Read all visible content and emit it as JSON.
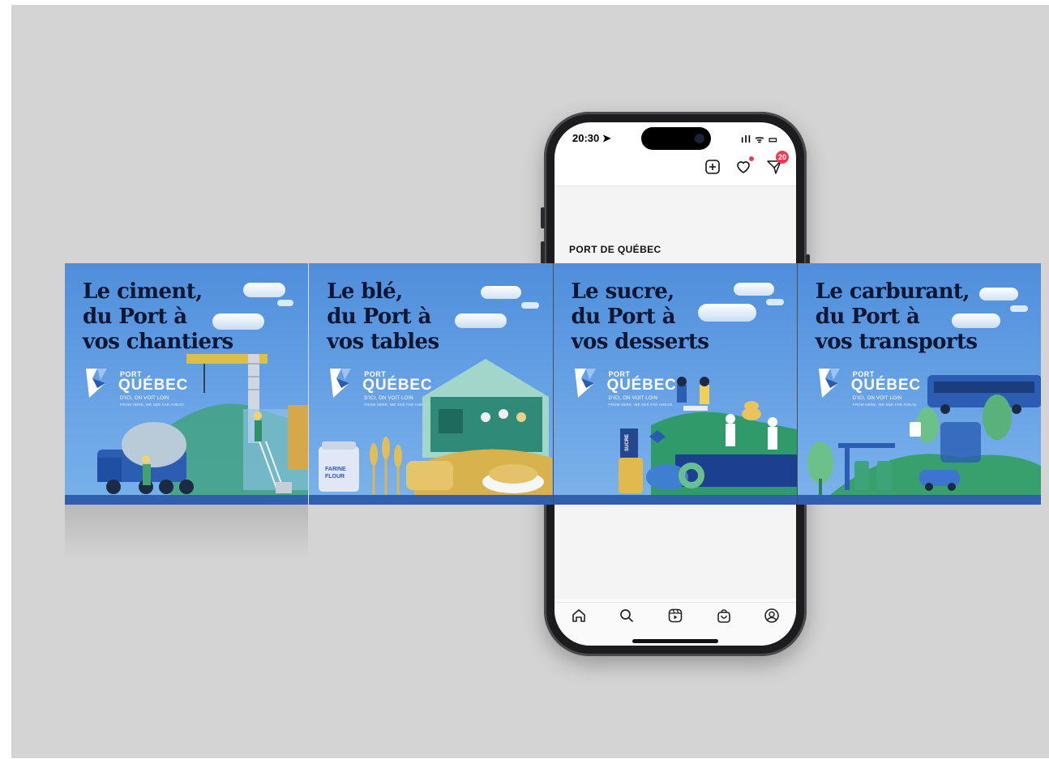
{
  "phone": {
    "time": "20:30 ➤",
    "status_icons": "ıll ᯤ ▭",
    "notification_count": "20",
    "account_name": "PORT DE QUÉBEC",
    "top_icons": [
      "plus-square-icon",
      "heart-icon",
      "send-icon"
    ],
    "nav_icons": [
      "home-icon",
      "search-icon",
      "reels-icon",
      "shop-icon",
      "profile-icon"
    ]
  },
  "panels": [
    {
      "headline": [
        "Le ciment,",
        "du Port à",
        "vos chantiers"
      ],
      "scene": "construction"
    },
    {
      "headline": [
        "Le blé,",
        "du Port à",
        "vos tables"
      ],
      "scene": "bakery"
    },
    {
      "headline": [
        "Le sucre,",
        "du Port à",
        "vos desserts"
      ],
      "scene": "desserts"
    },
    {
      "headline": [
        "Le carburant,",
        "du Port à",
        "vos transports"
      ],
      "scene": "transport"
    }
  ],
  "logo": {
    "port": "PORT",
    "name": "QUÉBEC",
    "tagline_fr": "D'ICI, ON VOIT LOIN",
    "tagline_en": "FROM HERE, WE SEE FAR AHEAD"
  },
  "illustration_labels": {
    "flour_bag": [
      "FARINE",
      "FLOUR"
    ],
    "sugar_box": "SUCRE"
  },
  "colors": {
    "panel_blue": "#4f8edb",
    "band": "#2e5fb0",
    "headline": "#0b1732",
    "badge": "#ef3a4f"
  }
}
